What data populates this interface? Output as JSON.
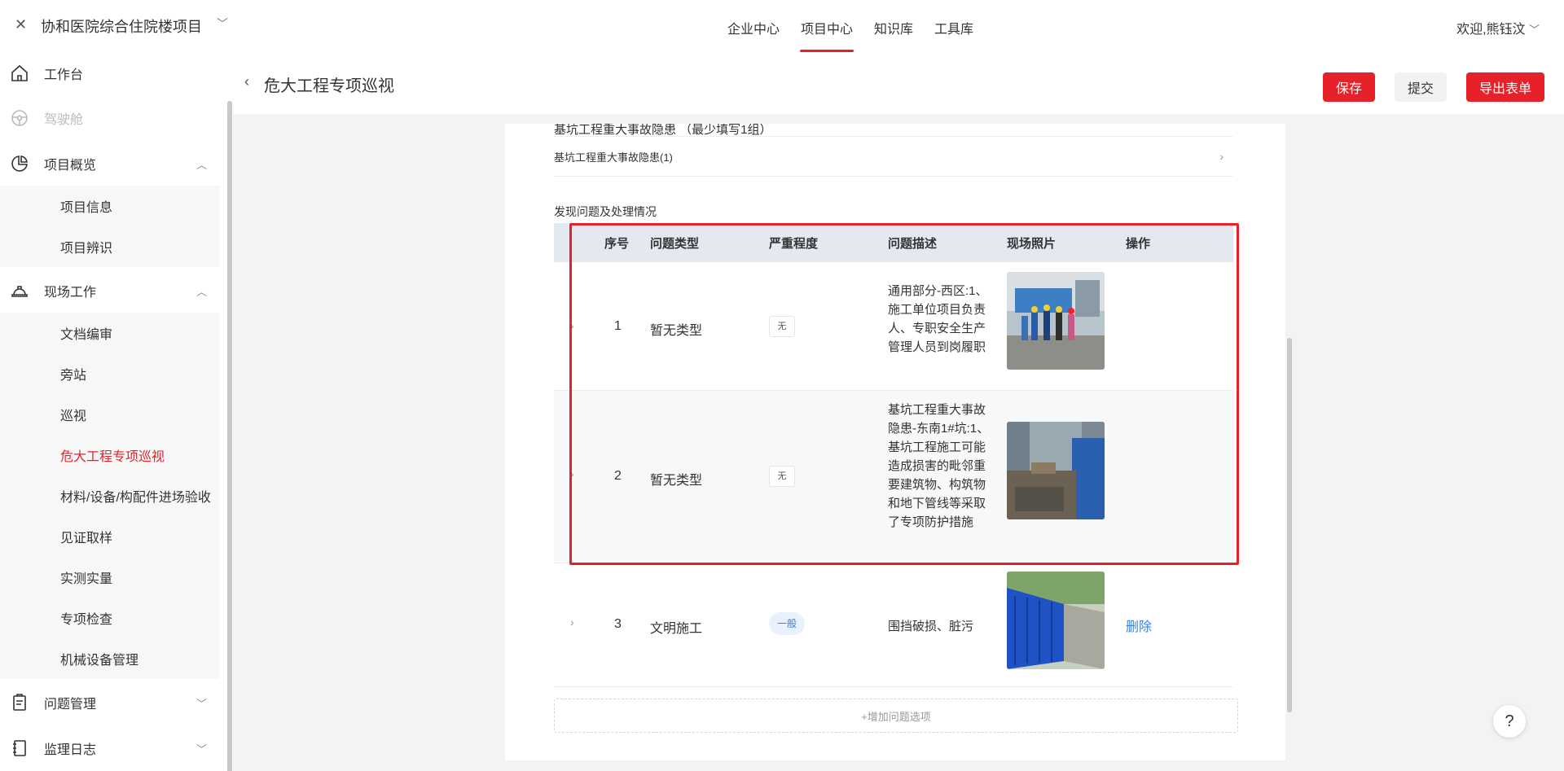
{
  "topbar": {
    "close_icon": "close-icon",
    "project_title": "协和医院综合住院楼项目",
    "nav": [
      "企业中心",
      "项目中心",
      "知识库",
      "工具库"
    ],
    "active_nav": "项目中心",
    "welcome": "欢迎,熊钰汶"
  },
  "sidebar": {
    "items": [
      {
        "label": "工作台",
        "icon": "home-icon"
      },
      {
        "label": "驾驶舱",
        "icon": "steering-wheel-icon"
      },
      {
        "label": "项目概览",
        "icon": "pie-chart-icon"
      },
      {
        "label": "项目信息"
      },
      {
        "label": "项目辨识"
      },
      {
        "label": "现场工作",
        "icon": "hard-hat-icon"
      },
      {
        "label": "文档编审"
      },
      {
        "label": "旁站"
      },
      {
        "label": "巡视"
      },
      {
        "label": "危大工程专项巡视"
      },
      {
        "label": "材料/设备/构配件进场验收"
      },
      {
        "label": "见证取样"
      },
      {
        "label": "实测实量"
      },
      {
        "label": "专项检查"
      },
      {
        "label": "机械设备管理"
      },
      {
        "label": "问题管理",
        "icon": "clipboard-icon"
      },
      {
        "label": "监理日志",
        "icon": "notebook-icon"
      }
    ]
  },
  "header": {
    "title": "危大工程专项巡视",
    "save": "保存",
    "submit": "提交",
    "export": "导出表单"
  },
  "form": {
    "section_title": "基坑工程重大事故隐患 （最少填写1组）",
    "group_link": "基坑工程重大事故隐患(1)",
    "issues_title": "发现问题及处理情况",
    "columns": [
      "序号",
      "问题类型",
      "严重程度",
      "问题描述",
      "现场照片",
      "操作"
    ],
    "rows": [
      {
        "no": "1",
        "type": "暂无类型",
        "severity": "无",
        "desc": "通用部分-西区:1、施工单位项目负责人、专职安全生产管理人员到岗履职",
        "action": ""
      },
      {
        "no": "2",
        "type": "暂无类型",
        "severity": "无",
        "desc": "基坑工程重大事故隐患-东南1#坑:1、基坑工程施工可能造成损害的毗邻重要建筑物、构筑物和地下管线等采取了专项防护措施",
        "action": ""
      },
      {
        "no": "3",
        "type": "文明施工",
        "severity": "一般",
        "desc": "围挡破损、脏污",
        "action": "删除"
      }
    ],
    "add_option": "+增加问题选项"
  },
  "colors": {
    "accent": "#e6212a",
    "link": "#3b82d8"
  }
}
